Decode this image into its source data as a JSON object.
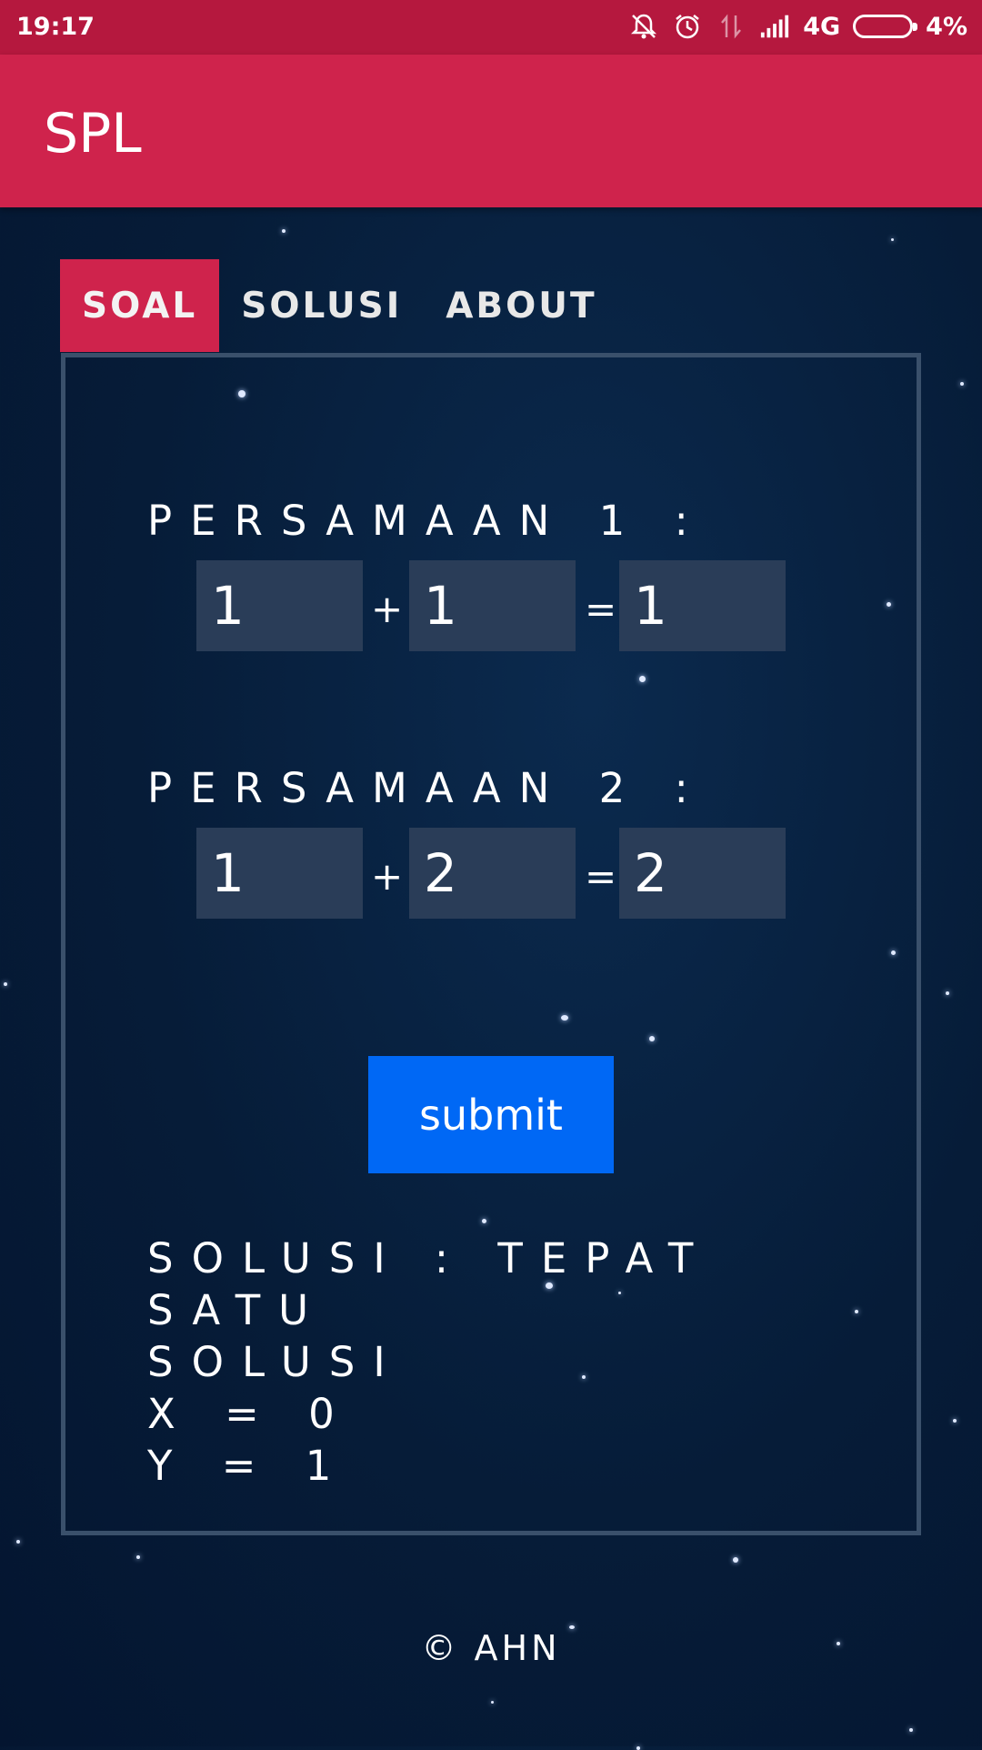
{
  "status_bar": {
    "time": "19:17",
    "network": "4G",
    "battery": "4%"
  },
  "app": {
    "title": "SPL"
  },
  "tabs": [
    {
      "label": "SOAL",
      "active": true
    },
    {
      "label": "SOLUSI",
      "active": false
    },
    {
      "label": "ABOUT",
      "active": false
    }
  ],
  "equations": [
    {
      "label": "PERSAMAAN 1 :",
      "a": "1",
      "plus": "+",
      "b": "1",
      "equals": "=",
      "c": "1"
    },
    {
      "label": "PERSAMAAN 2 :",
      "a": "1",
      "plus": "+",
      "b": "2",
      "equals": "=",
      "c": "2"
    }
  ],
  "submit_label": "submit",
  "solution": {
    "line1": "SOLUSI : TEPAT SATU",
    "line2": "SOLUSI",
    "x": "X = 0",
    "y": "Y = 1"
  },
  "footer": "© AHN",
  "colors": {
    "status_bar": "#b5183e",
    "app_bar": "#cf234c",
    "submit": "#0068f5",
    "input": "#2a3d58"
  }
}
